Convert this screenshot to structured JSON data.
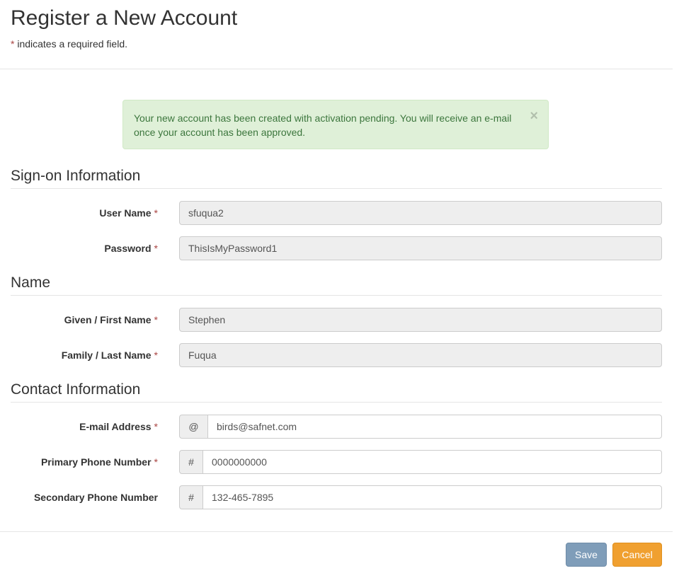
{
  "page": {
    "title": "Register a New Account",
    "required_star": "*",
    "required_note": " indicates a required field."
  },
  "alert": {
    "message": "Your new account has been created with activation pending. You will receive an e-mail once your account has been approved.",
    "close_glyph": "×",
    "colors": {
      "background": "#dff0d8",
      "text": "#3c763d"
    }
  },
  "sections": {
    "signon": {
      "title": "Sign-on Information"
    },
    "name": {
      "title": "Name"
    },
    "contact": {
      "title": "Contact Information"
    }
  },
  "fields": {
    "username": {
      "label": "User Name",
      "required": "*",
      "value": "sfuqua2"
    },
    "password": {
      "label": "Password",
      "required": "*",
      "value": "ThisIsMyPassword1"
    },
    "first_name": {
      "label": "Given / First Name",
      "required": "*",
      "value": "Stephen"
    },
    "last_name": {
      "label": "Family / Last Name",
      "required": "*",
      "value": "Fuqua"
    },
    "email": {
      "label": "E-mail Address",
      "required": "*",
      "addon": "@",
      "value": "birds@safnet.com"
    },
    "primary_phone": {
      "label": "Primary Phone Number",
      "required": "*",
      "addon": "#",
      "value": "0000000000"
    },
    "secondary_phone": {
      "label": "Secondary Phone Number",
      "addon": "#",
      "value": "132-465-7895"
    }
  },
  "buttons": {
    "save": "Save",
    "cancel": "Cancel"
  },
  "colors": {
    "required": "#a94442",
    "save_button": "#7f9db9",
    "cancel_button": "#f0a030"
  }
}
